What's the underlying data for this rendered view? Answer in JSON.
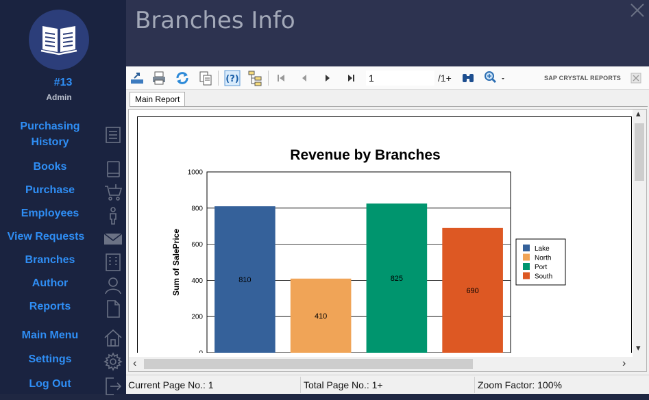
{
  "user": {
    "id": "#13",
    "role": "Admin"
  },
  "nav": [
    {
      "label": "Purchasing History",
      "icon": "receipt-icon"
    },
    {
      "label": "Books",
      "icon": "book-icon"
    },
    {
      "label": "Purchase",
      "icon": "cart-icon"
    },
    {
      "label": "Employees",
      "icon": "person-icon"
    },
    {
      "label": "View Requests",
      "icon": "mail-icon"
    },
    {
      "label": "Branches",
      "icon": "building-icon"
    },
    {
      "label": "Author",
      "icon": "user-icon"
    },
    {
      "label": "Reports",
      "icon": "document-icon"
    },
    {
      "label": "Main Menu",
      "icon": "home-icon"
    },
    {
      "label": "Settings",
      "icon": "gear-icon"
    },
    {
      "label": "Log Out",
      "icon": "logout-icon"
    }
  ],
  "header": {
    "title": "Branches Info"
  },
  "toolbar": {
    "page_value": "1",
    "page_total": "/1+",
    "brand": "SAP CRYSTAL REPORTS"
  },
  "tabs": {
    "main": "Main Report"
  },
  "status": {
    "current_page": "Current Page No.: 1",
    "total_page": "Total Page No.: 1+",
    "zoom": "Zoom Factor: 100%"
  },
  "chart_data": {
    "type": "bar",
    "title": "Revenue by Branches",
    "ylabel": "Sum of SalePrice",
    "xlabel": "",
    "categories": [
      "Lake",
      "North",
      "Port",
      "South"
    ],
    "values": [
      810,
      410,
      825,
      690
    ],
    "colors": [
      "#35619a",
      "#f0a457",
      "#00956e",
      "#dd5823"
    ],
    "ylim": [
      0,
      1000
    ],
    "yticks": [
      0,
      200,
      400,
      600,
      800,
      1000
    ],
    "grid": true,
    "legend": [
      "Lake",
      "North",
      "Port",
      "South"
    ],
    "legend_position": "right"
  }
}
